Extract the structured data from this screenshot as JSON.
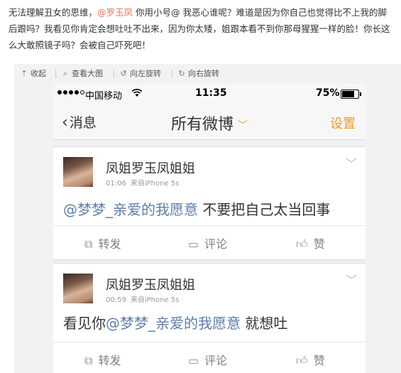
{
  "post": {
    "text_before": "无法理解丑女的思维，",
    "mention": "@罗玉凤",
    "text_after": " 你用小号@ 我恶心谁呢？难道是因为你自己也觉得比不上我的脚后跟吗？我看见你肯定会想吐吐不出来，因为你太矮，姐跟本看不到你那母猩猩一样的脸！你长这么大敢照镜子吗？会被自己吓死吧！"
  },
  "toolbar": {
    "collapse": {
      "icon": "collapse-icon",
      "label": "收起"
    },
    "view_large": {
      "icon": "search-icon",
      "label": "查看大图"
    },
    "rotate_left": {
      "icon": "rotate-left-icon",
      "label": "向左旋转"
    },
    "rotate_right": {
      "icon": "rotate-right-icon",
      "label": "向右旋转"
    }
  },
  "phone": {
    "status": {
      "carrier": "中国移动",
      "time": "11:35",
      "battery": "75%",
      "battery_level": 0.75
    },
    "nav": {
      "back": "消息",
      "title": "所有微博",
      "settings": "设置"
    },
    "accent_color": "#f39a26",
    "link_color": "#5d7ea8",
    "cards": [
      {
        "name": "凤姐罗玉凤姐姐",
        "time": "01:06",
        "source": "来自iPhone 5s",
        "text_prefix": "",
        "mention": "@梦梦_亲爱的我愿意",
        "text_suffix": " 不要把自己太当回事",
        "actions": {
          "repost": "转发",
          "comment": "评论",
          "like": "赞"
        }
      },
      {
        "name": "凤姐罗玉凤姐姐",
        "time": "00:59",
        "source": "来自iPhone 5s",
        "text_prefix": "看见你",
        "mention": "@梦梦_亲爱的我愿意",
        "text_suffix": " 就想吐",
        "actions": {
          "repost": "转发",
          "comment": "评论",
          "like": "赞"
        }
      }
    ]
  }
}
